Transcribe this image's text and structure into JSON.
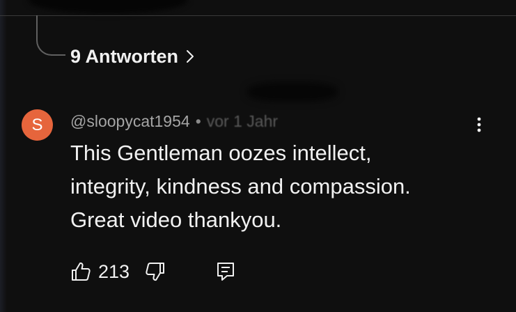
{
  "thread": {
    "replies_label": "9 Antworten"
  },
  "comment": {
    "avatar_letter": "S",
    "avatar_color": "#e6653c",
    "author": "@sloopycat1954",
    "separator": "•",
    "time": "vor 1 Jahr",
    "text_lines": [
      "This Gentleman oozes intellect,",
      "integrity, kindness and compassion.",
      "Great video thankyou."
    ],
    "like_count": "213"
  },
  "icons": {
    "replies_chevron": "chevron-right-icon",
    "menu": "more-vert-icon",
    "like": "thumb-up-icon",
    "dislike": "thumb-down-icon",
    "reply": "reply-comment-icon"
  },
  "colors": {
    "background": "#0f0f0f",
    "text_primary": "#f1f1f1",
    "text_secondary": "#a5a5a5"
  }
}
